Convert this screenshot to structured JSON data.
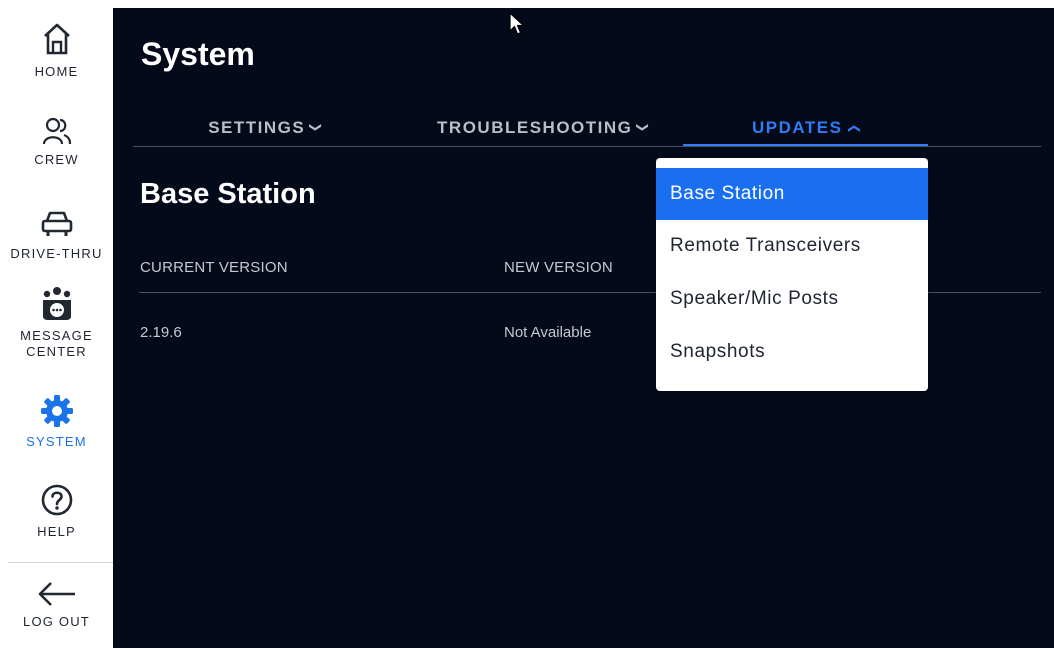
{
  "sidebar": {
    "items": [
      {
        "label": "HOME",
        "icon": "home-icon"
      },
      {
        "label": "CREW",
        "icon": "crew-icon"
      },
      {
        "label": "DRIVE-THRU",
        "icon": "car-icon"
      },
      {
        "label": "MESSAGE\nCENTER",
        "icon": "message-center-icon"
      },
      {
        "label": "SYSTEM",
        "icon": "gear-icon"
      },
      {
        "label": "HELP",
        "icon": "help-icon"
      },
      {
        "label": "LOG OUT",
        "icon": "arrow-left-icon"
      }
    ],
    "active": "SYSTEM"
  },
  "header": {
    "title": "System"
  },
  "tabs": [
    {
      "label": "SETTINGS",
      "chevron": "down"
    },
    {
      "label": "TROUBLESHOOTING",
      "chevron": "down"
    },
    {
      "label": "UPDATES",
      "chevron": "up"
    }
  ],
  "section": {
    "title": "Base Station",
    "columns": [
      "CURRENT VERSION",
      "NEW VERSION"
    ],
    "row": {
      "current_version": "2.19.6",
      "new_version": "Not Available"
    }
  },
  "updates_menu": {
    "items": [
      "Base Station",
      "Remote Transceivers",
      "Speaker/Mic Posts",
      "Snapshots"
    ],
    "selected": "Base Station"
  },
  "colors": {
    "background": "#050a1a",
    "accent": "#2f7cf6",
    "selected_item": "#1a6ef0",
    "sidebar": "#ffffff"
  }
}
